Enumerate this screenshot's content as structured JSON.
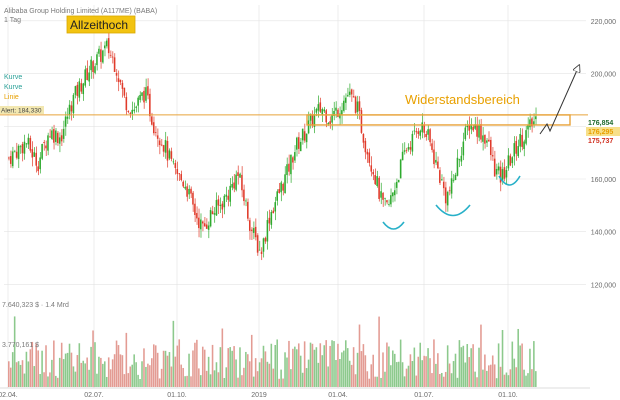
{
  "header": {
    "instrument": "Alibaba Group Holding Limited (A117ME) (BABA)",
    "interval": "1 Tag"
  },
  "legend": {
    "items": [
      "Kurve",
      "Kurve",
      "Linie"
    ],
    "colors": [
      "#2aa198",
      "#2aa198",
      "#e8a000"
    ]
  },
  "annotations": {
    "ath": "Allzeithoch",
    "resistance": "Widerstandsbereich",
    "alert": "Alert: 184,330"
  },
  "volume": {
    "label_top": "7.640,323 $ · 1.4 Mrd",
    "label_mid": "3.770,161 $"
  },
  "colors": {
    "up": "#2eaa2e",
    "down": "#e03b2b",
    "resistance": "#e8a33a",
    "grid": "#e3e3e3",
    "cup": "#27b0c8",
    "label_last": "#1f6b2e",
    "label_mid": "#e8a000",
    "label_low": "#d03020"
  },
  "chart_data": {
    "type": "candlestick",
    "title": "Alibaba Group Holding Limited (A117ME) (BABA)",
    "interval": "1 Tag",
    "ylim": [
      116,
      226
    ],
    "y_ticks": [
      120,
      140,
      160,
      180,
      200,
      220
    ],
    "y_tick_labels": [
      "120,000",
      "140,000",
      "160,000",
      "180,000",
      "200,000",
      "220,000"
    ],
    "x_ticks": [
      "02.04.",
      "02.07.",
      "01.10.",
      "2019",
      "01.04.",
      "01.07.",
      "01.10."
    ],
    "price_path": [
      {
        "t": 0,
        "v": 168
      },
      {
        "t": 6,
        "v": 174
      },
      {
        "t": 10,
        "v": 166
      },
      {
        "t": 14,
        "v": 178
      },
      {
        "t": 18,
        "v": 176
      },
      {
        "t": 22,
        "v": 190
      },
      {
        "t": 25,
        "v": 196
      },
      {
        "t": 28,
        "v": 202
      },
      {
        "t": 31,
        "v": 206
      },
      {
        "t": 34,
        "v": 210
      },
      {
        "t": 37,
        "v": 203
      },
      {
        "t": 40,
        "v": 190
      },
      {
        "t": 43,
        "v": 186
      },
      {
        "t": 47,
        "v": 193
      },
      {
        "t": 50,
        "v": 181
      },
      {
        "t": 54,
        "v": 172
      },
      {
        "t": 57,
        "v": 163
      },
      {
        "t": 61,
        "v": 158
      },
      {
        "t": 64,
        "v": 148
      },
      {
        "t": 67,
        "v": 141
      },
      {
        "t": 70,
        "v": 147
      },
      {
        "t": 73,
        "v": 150
      },
      {
        "t": 76,
        "v": 155
      },
      {
        "t": 79,
        "v": 162
      },
      {
        "t": 81,
        "v": 154
      },
      {
        "t": 84,
        "v": 140
      },
      {
        "t": 87,
        "v": 132
      },
      {
        "t": 90,
        "v": 146
      },
      {
        "t": 93,
        "v": 154
      },
      {
        "t": 96,
        "v": 162
      },
      {
        "t": 99,
        "v": 172
      },
      {
        "t": 102,
        "v": 177
      },
      {
        "t": 105,
        "v": 183
      },
      {
        "t": 108,
        "v": 187
      },
      {
        "t": 111,
        "v": 183
      },
      {
        "t": 114,
        "v": 187
      },
      {
        "t": 117,
        "v": 192
      },
      {
        "t": 120,
        "v": 188
      },
      {
        "t": 123,
        "v": 174
      },
      {
        "t": 126,
        "v": 163
      },
      {
        "t": 129,
        "v": 150
      },
      {
        "t": 131,
        "v": 149
      },
      {
        "t": 134,
        "v": 160
      },
      {
        "t": 137,
        "v": 171
      },
      {
        "t": 140,
        "v": 176
      },
      {
        "t": 142,
        "v": 181
      },
      {
        "t": 145,
        "v": 175
      },
      {
        "t": 148,
        "v": 164
      },
      {
        "t": 151,
        "v": 153
      },
      {
        "t": 153,
        "v": 157
      },
      {
        "t": 156,
        "v": 171
      },
      {
        "t": 159,
        "v": 181
      },
      {
        "t": 162,
        "v": 179
      },
      {
        "t": 165,
        "v": 175
      },
      {
        "t": 168,
        "v": 163
      },
      {
        "t": 170,
        "v": 160
      },
      {
        "t": 173,
        "v": 167
      },
      {
        "t": 176,
        "v": 174
      },
      {
        "t": 179,
        "v": 178
      },
      {
        "t": 182,
        "v": 183
      }
    ],
    "series": [
      {
        "name": "Linie",
        "type": "hline",
        "value": 184.33
      }
    ],
    "resistance_band": [
      180.5,
      184.3
    ],
    "price_labels": [
      {
        "text": "176,854",
        "value": 176.854
      },
      {
        "text": "176,295",
        "value": 176.295
      },
      {
        "text": "175,737",
        "value": 175.737
      }
    ]
  }
}
